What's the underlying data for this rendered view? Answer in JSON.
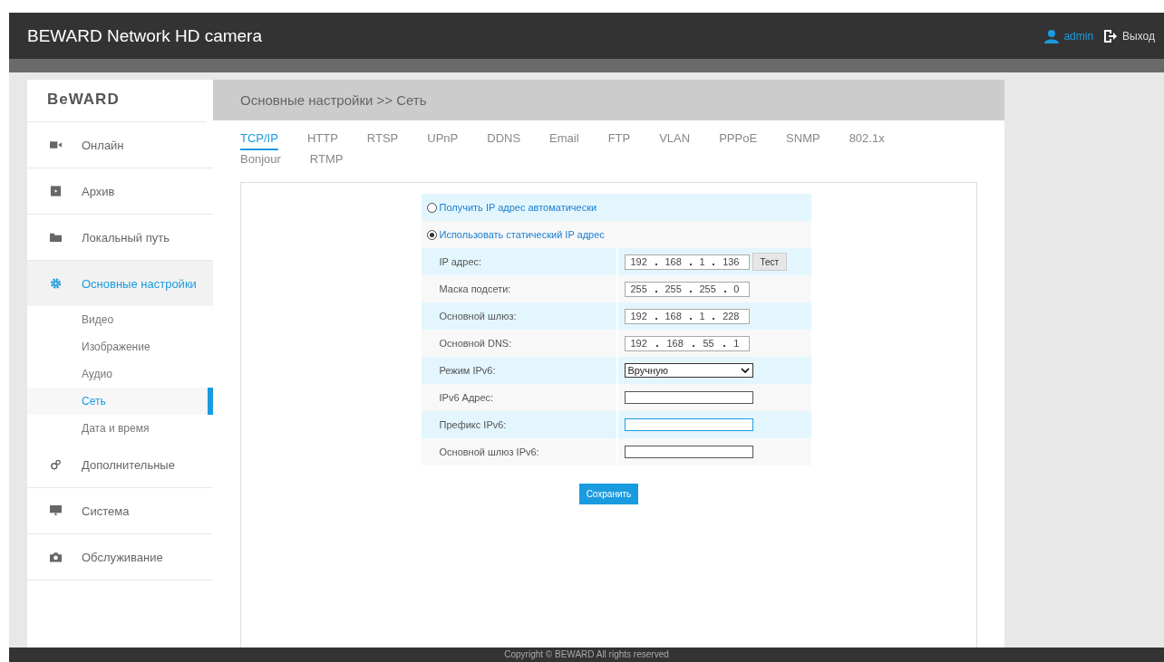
{
  "header": {
    "title": "BEWARD Network HD camera",
    "user": "admin",
    "logout": "Выход"
  },
  "logo": "BeWARD",
  "sidebar": {
    "items": [
      {
        "label": "Онлайн",
        "selected": false
      },
      {
        "label": "Архив",
        "selected": false
      },
      {
        "label": "Локальный путь",
        "selected": false
      },
      {
        "label": "Основные настройки",
        "selected": true,
        "children": [
          {
            "label": "Видео",
            "selected": false
          },
          {
            "label": "Изображение",
            "selected": false
          },
          {
            "label": "Аудио",
            "selected": false
          },
          {
            "label": "Сеть",
            "selected": true
          },
          {
            "label": "Дата и время",
            "selected": false
          }
        ]
      },
      {
        "label": "Дополнительные",
        "selected": false
      },
      {
        "label": "Система",
        "selected": false
      },
      {
        "label": "Обслуживание",
        "selected": false
      }
    ]
  },
  "breadcrumb": "Основные настройки >> Сеть",
  "tabs": [
    {
      "label": "TCP/IP",
      "selected": true
    },
    {
      "label": "HTTP",
      "selected": false
    },
    {
      "label": "RTSP",
      "selected": false
    },
    {
      "label": "UPnP",
      "selected": false
    },
    {
      "label": "DDNS",
      "selected": false
    },
    {
      "label": "Email",
      "selected": false
    },
    {
      "label": "FTP",
      "selected": false
    },
    {
      "label": "VLAN",
      "selected": false
    },
    {
      "label": "PPPoE",
      "selected": false
    },
    {
      "label": "SNMP",
      "selected": false
    },
    {
      "label": "802.1x",
      "selected": false
    },
    {
      "label": "Bonjour",
      "selected": false
    },
    {
      "label": "RTMP",
      "selected": false
    }
  ],
  "form": {
    "rows": [
      {
        "kind": "radio",
        "label": "Получить IP адрес автоматически",
        "selected": false
      },
      {
        "kind": "radio",
        "label": "Использовать статический IP адрес",
        "selected": true
      },
      {
        "kind": "ip",
        "label": "IP адрес:",
        "octets": [
          "192",
          "168",
          "1",
          "136"
        ],
        "button": "Тест"
      },
      {
        "kind": "ip",
        "label": "Маска подсети:",
        "octets": [
          "255",
          "255",
          "255",
          "0"
        ]
      },
      {
        "kind": "ip",
        "label": "Основной шлюз:",
        "octets": [
          "192",
          "168",
          "1",
          "228"
        ]
      },
      {
        "kind": "ip",
        "label": "Основной DNS:",
        "octets": [
          "192",
          "168",
          "55",
          "1"
        ]
      },
      {
        "kind": "select",
        "label": "Режим IPv6:",
        "value": "Вручную"
      },
      {
        "kind": "text",
        "label": "IPv6 Адрес:",
        "focused": false
      },
      {
        "kind": "text",
        "label": "Префикс IPv6:",
        "focused": true
      },
      {
        "kind": "text",
        "label": "Основной шлюз IPv6:",
        "focused": false
      }
    ],
    "save": "Сохранить"
  },
  "footer": "Copyright © BEWARD All rights reserved"
}
